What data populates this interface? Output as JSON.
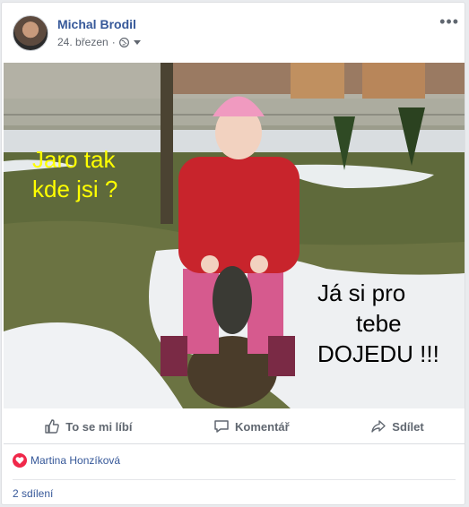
{
  "post": {
    "author": "Michal Brodil",
    "date": "24. březen",
    "photo_text": {
      "left_line1": "Jaro tak",
      "left_line2": "kde jsi ?",
      "right_line1": "Já si pro",
      "right_line2": "tebe",
      "right_line3": "DOJEDU !!!"
    }
  },
  "actions": {
    "like": "To se mi líbí",
    "comment": "Komentář",
    "share": "Sdílet"
  },
  "reactions": {
    "names": "Martina Honzíková",
    "icon": "heart-icon",
    "color": "#f0284a"
  },
  "shares": "2 sdílení",
  "colors": {
    "link": "#365899",
    "photo_text": "#ffff00"
  }
}
